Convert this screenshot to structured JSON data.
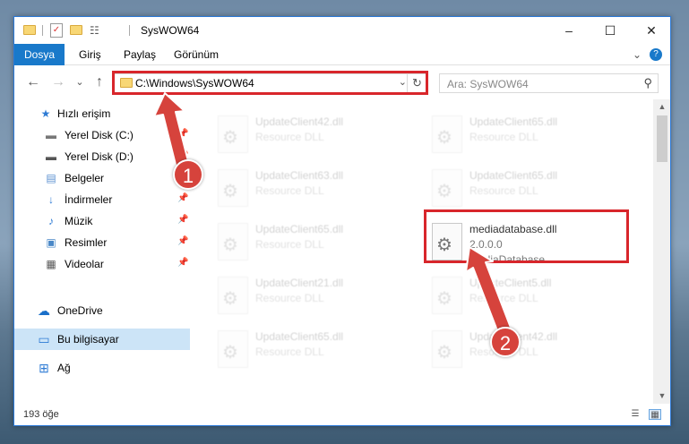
{
  "window": {
    "title": "SysWOW64",
    "controls": {
      "minimize": "–",
      "maximize": "☐",
      "close": "✕"
    }
  },
  "ribbon": {
    "tabs": [
      "Dosya",
      "Giriş",
      "Paylaş",
      "Görünüm"
    ],
    "expand": "⌄",
    "help": "?"
  },
  "nav": {
    "back": "←",
    "forward": "→",
    "recent": "⌄",
    "up": "↑"
  },
  "address": {
    "path": "C:\\Windows\\SysWOW64",
    "dropdown": "⌄",
    "refresh": "↻"
  },
  "search": {
    "placeholder": "Ara: SysWOW64",
    "icon": "⚲"
  },
  "sidebar": {
    "items": [
      {
        "label": "Hızlı erişim",
        "icon": "★"
      },
      {
        "label": "Yerel Disk (C:)",
        "icon": "▬"
      },
      {
        "label": "Yerel Disk (D:)",
        "icon": "▬"
      },
      {
        "label": "Belgeler",
        "icon": "▤"
      },
      {
        "label": "İndirmeler",
        "icon": "↓"
      },
      {
        "label": "Müzik",
        "icon": "♪"
      },
      {
        "label": "Resimler",
        "icon": "▣"
      },
      {
        "label": "Videolar",
        "icon": "▦"
      },
      {
        "label": "OneDrive",
        "icon": "☁"
      },
      {
        "label": "Bu bilgisayar",
        "icon": "▭"
      },
      {
        "label": "Ağ",
        "icon": "⊞"
      }
    ],
    "pin": "📌"
  },
  "files": [
    {
      "name": "UpdateClient42.dll",
      "line2": "Resource DLL",
      "line3": ""
    },
    {
      "name": "UpdateClient65.dll",
      "line2": "Resource DLL",
      "line3": ""
    },
    {
      "name": "UpdateClient63.dll",
      "line2": "Resource DLL",
      "line3": ""
    },
    {
      "name": "UpdateClient65.dll",
      "line2": "Resource DLL",
      "line3": ""
    },
    {
      "name": "UpdateClient65.dll",
      "line2": "Resource DLL",
      "line3": ""
    },
    {
      "name": "mediadatabase.dll",
      "line2": "2.0.0.0",
      "line3": "MediaDatabase"
    },
    {
      "name": "UpdateClient21.dll",
      "line2": "Resource DLL",
      "line3": ""
    },
    {
      "name": "UpdateClient5.dll",
      "line2": "Resource DLL",
      "line3": ""
    },
    {
      "name": "UpdateClient65.dll",
      "line2": "Resource DLL",
      "line3": ""
    },
    {
      "name": "UpdateClient42.dll",
      "line2": "Resource DLL",
      "line3": ""
    }
  ],
  "status": {
    "count": "193 öğe",
    "view_details": "☰",
    "view_icons": "▦"
  },
  "scrollbar": {
    "up": "▲",
    "down": "▼"
  },
  "annotations": {
    "step1": "1",
    "step2": "2"
  },
  "colors": {
    "accent": "#1979ca",
    "highlight": "#d8262b",
    "badge": "#d6433c"
  }
}
